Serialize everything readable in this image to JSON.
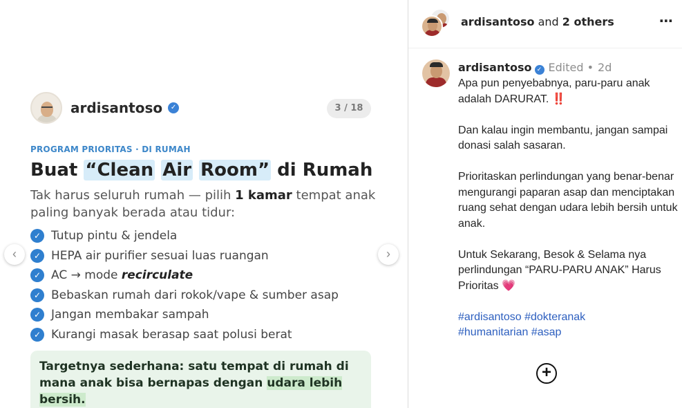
{
  "slide": {
    "username": "ardisantoso",
    "counter": "3 / 18",
    "program": "PROGRAM PRIORITAS · DI RUMAH",
    "headline": {
      "prefix": "Buat ",
      "quote_open": "“",
      "word1": "Clean",
      "word2": "Air",
      "word3": "Room",
      "quote_close": "”",
      "suffix": " di Rumah"
    },
    "subtext": {
      "part1": "Tak harus seluruh rumah — pilih ",
      "bold": "1 kamar",
      "part2": " tempat anak paling banyak berada atau tidur:"
    },
    "checklist": [
      "Tutup pintu & jendela",
      "HEPA air purifier sesuai luas ruangan",
      "AC → mode ",
      "Bebaskan rumah dari rokok/vape & sumber asap",
      "Jangan membakar sampah",
      "Kurangi masak berasap saat polusi berat"
    ],
    "checklist_emph": "recirculate",
    "target": {
      "part1": "Targetnya sederhana: satu tempat di rumah di mana anak bisa bernapas dengan ",
      "highlight1": "udara lebih",
      "space": " ",
      "highlight2": "bersih."
    },
    "check_glyph": "✓",
    "prev_arrow": "‹",
    "next_arrow": "›"
  },
  "panel": {
    "header": {
      "user": "ardisantoso",
      "and": " and ",
      "others": "2 others",
      "more": "⋯"
    },
    "comment": {
      "user": "ardisantoso",
      "edited": "Edited •",
      "time": "2d",
      "p1": "Apa pun penyebabnya, paru-paru anak adalah DARURAT. ",
      "p1_emoji": "‼️",
      "p2": "Dan kalau ingin membantu, jangan sampai donasi salah sasaran.",
      "p3": "Prioritaskan perlindungan yang benar-benar mengurangi paparan asap dan menciptakan ruang sehat dengan udara lebih bersih untuk anak.",
      "p4_line1": "Untuk Sekarang, Besok & Selama nya perlindungan “PARU-PARU ANAK” Harus Prioritas ",
      "p4_emoji": "💗",
      "hashtags": [
        "#ardisantoso",
        "#dokteranak",
        "#humanitarian",
        "#asap"
      ]
    },
    "add_icon": "+"
  },
  "colors": {
    "accent_blue": "#3d87c9",
    "check_blue": "#2f7fcf",
    "hashtag": "#2d5fbf",
    "target_bg": "#e9f4ea"
  }
}
